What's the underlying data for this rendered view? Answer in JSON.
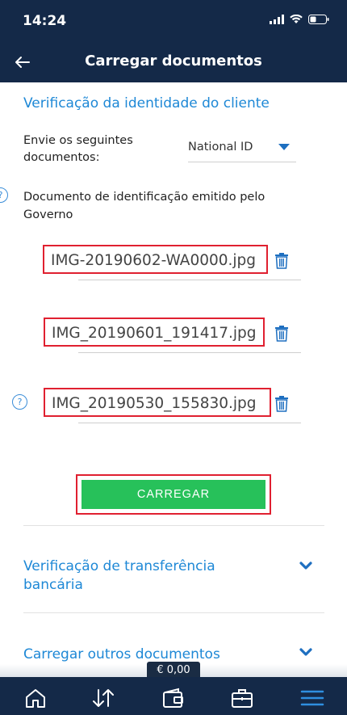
{
  "status": {
    "time": "14:24"
  },
  "header": {
    "title": "Carregar documentos"
  },
  "identity": {
    "title": "Verificação da identidade do cliente",
    "send_label": "Envie os seguintes documentos:",
    "doc_type": "National ID",
    "gov_doc_label": "Documento de identificação emitido pelo Governo",
    "files": [
      "IMG-20190602-WA0000.jpg",
      "IMG_20190601_191417.jpg",
      "IMG_20190530_155830.jpg"
    ],
    "help": "?",
    "upload_label": "CARREGAR"
  },
  "accordions": [
    {
      "title": "Verificação de transferência bancária"
    },
    {
      "title": "Carregar outros documentos"
    }
  ],
  "balance": "€ 0,00",
  "tabbar": [
    "home-icon",
    "transfer-icon",
    "wallet-icon",
    "briefcase-icon",
    "menu-icon"
  ],
  "colors": {
    "navy": "#142948",
    "blue": "#1e88d6",
    "green": "#27c15a",
    "red_outline": "#e02030"
  }
}
